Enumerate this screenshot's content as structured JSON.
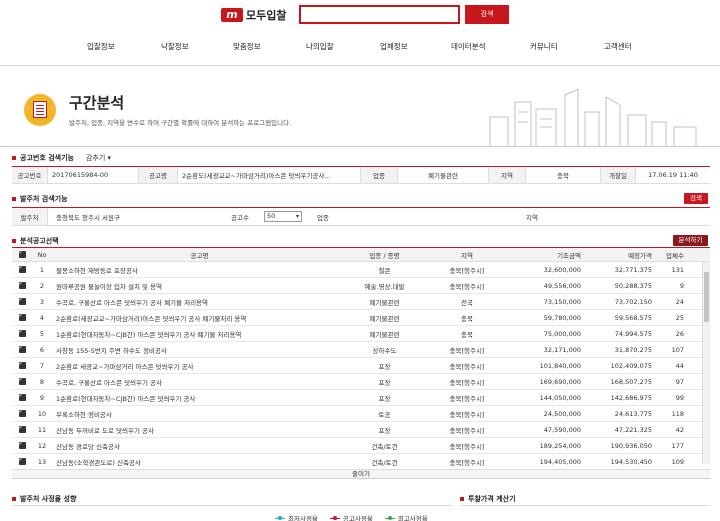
{
  "header": {
    "logo_mark": "m",
    "logo_text": "모두입찰",
    "search_placeholder": "",
    "search_button": "검색",
    "nav": [
      "입찰정보",
      "낙찰정보",
      "맞춤정보",
      "나의입찰",
      "업체정보",
      "데이터분석",
      "커뮤니티",
      "고객센터"
    ]
  },
  "page": {
    "title": "구간분석",
    "description": "발주처, 업종, 지역을 변수로 하여 구간별 확률에 대하여 분석하는 프로그램입니다."
  },
  "notice_search": {
    "title": "공고번호 검색기능",
    "toggle": "감추기",
    "labels": [
      "공고번호",
      "공고명",
      "업종",
      "지역",
      "개찰일"
    ],
    "notice_no": "20170615984-00",
    "notice_name": "2순환도(세광교교~가마삼거리)아스콘 덧씌우기공사...",
    "category": "폐기물관련",
    "region": "충북",
    "open_date": "17.06.19 11:40"
  },
  "orderer_search": {
    "title": "발주처 검색기능",
    "search_button": "검색",
    "orderer_label": "발주처",
    "orderer_value": "충청북도 청주시 서원구",
    "count_label": "공고수",
    "count_value": "50",
    "category_label": "업종",
    "region_label": "지역"
  },
  "selection": {
    "title": "분석공고선택",
    "analyze_button": "분석하기",
    "columns": [
      "No",
      "공고명",
      "업종 / 종명",
      "지역",
      "기초금액",
      "예정가격",
      "업체수"
    ],
    "rows": [
      {
        "no": "1",
        "name": "팔봉소하천 재방동로 포장공사",
        "cat": "철콘",
        "region": "충북[청주시]",
        "base": "32,600,000",
        "exp": "32,771,375",
        "cnt": "131"
      },
      {
        "no": "2",
        "name": "원마루공원 물놀이장 입차 설치 및 용역",
        "cat": "예술.영상.대발",
        "region": "충북[청주시]",
        "base": "49,556,000",
        "exp": "50,288,375",
        "cnt": "9"
      },
      {
        "no": "3",
        "name": "수곡로, 구룡산로 아스콘 덧씌우기 공사 폐기물 처리용역",
        "cat": "폐기물관련",
        "region": "전국",
        "base": "73,150,000",
        "exp": "73,702,150",
        "cnt": "24"
      },
      {
        "no": "4",
        "name": "2순환로(세광교교~가마삼거리)아스콘 덧씌우기 공사 폐기물처리 용역",
        "cat": "폐기물관련",
        "region": "충북",
        "base": "59,780,000",
        "exp": "59,568,575",
        "cnt": "25"
      },
      {
        "no": "5",
        "name": "1순환로(현대자동차~CJB간) 아스콘 덧씌우기 공사 폐기물 처리용역",
        "cat": "폐기물관련",
        "region": "충북",
        "base": "75,000,000",
        "exp": "74,994,575",
        "cnt": "26"
      },
      {
        "no": "6",
        "name": "사창동 155-5번지 주변 하수도 정비공사",
        "cat": "상하수도",
        "region": "충북[청주시]",
        "base": "32,171,000",
        "exp": "31,870,275",
        "cnt": "107"
      },
      {
        "no": "7",
        "name": "2순환로 세광교~가마삼거리 아스콘 덧씌우기 공사",
        "cat": "포장",
        "region": "충북[청주시]",
        "base": "101,840,000",
        "exp": "102,409,075",
        "cnt": "44"
      },
      {
        "no": "8",
        "name": "수곡로, 구룡산로 아스콘 덧씌우기 공사",
        "cat": "포장",
        "region": "충북[청주시]",
        "base": "169,690,000",
        "exp": "168,507,275",
        "cnt": "97"
      },
      {
        "no": "9",
        "name": "1순환로(현대자동차~CJB간) 아스콘 덧씌우기 공사",
        "cat": "포장",
        "region": "충북[청주시]",
        "base": "144,050,000",
        "exp": "142,686,975",
        "cnt": "99"
      },
      {
        "no": "10",
        "name": "우록소하천 정비공사",
        "cat": "토공",
        "region": "충북[청주시]",
        "base": "24,500,000",
        "exp": "24,613,775",
        "cnt": "118"
      },
      {
        "no": "11",
        "name": "산남동 두꺼비로 도로 덧씌우기 공사",
        "cat": "포장",
        "region": "충북[청주시]",
        "base": "47,590,000",
        "exp": "47,221,325",
        "cnt": "42"
      },
      {
        "no": "12",
        "name": "산남동 경로당 신축공사",
        "cat": "건축/토건",
        "region": "충북[청주시]",
        "base": "189,254,000",
        "exp": "190,936,050",
        "cnt": "177"
      },
      {
        "no": "13",
        "name": "산남동(소학경관도로) 신축공사",
        "cat": "건축/토건",
        "region": "충북[청주시]",
        "base": "194,405,000",
        "exp": "194,530,450",
        "cnt": "109"
      }
    ],
    "more": "줄이기"
  },
  "bottom": {
    "left_title": "발주처 사정율 성향",
    "legend": [
      "최저사정율",
      "공고사정율",
      "최고사정율"
    ],
    "right_title": "투찰가격 계산기"
  },
  "colors": {
    "brand": "#c8161d",
    "legend_min": "#2aa8c8",
    "legend_notice": "#c8161d",
    "legend_max": "#3ca640"
  }
}
